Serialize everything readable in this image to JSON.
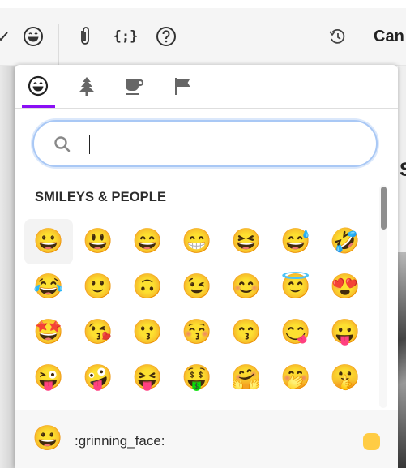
{
  "toolbar": {
    "icons": [
      {
        "name": "checkmark-icon",
        "glyph": "✓"
      },
      {
        "name": "emoji-icon",
        "glyph": "😄"
      },
      {
        "name": "paperclip-icon",
        "glyph": ""
      },
      {
        "name": "code-snippet-icon",
        "glyph": "{;}"
      },
      {
        "name": "help-icon",
        "glyph": "?"
      },
      {
        "name": "history-icon",
        "glyph": ""
      }
    ],
    "cancel_label": "Can"
  },
  "background": {
    "partial_heading": "S"
  },
  "picker": {
    "tabs": [
      {
        "name": "smileys",
        "icon": "smiley-icon",
        "active": true
      },
      {
        "name": "nature",
        "icon": "tree-icon",
        "active": false
      },
      {
        "name": "food",
        "icon": "cup-icon",
        "active": false
      },
      {
        "name": "flags",
        "icon": "flag-icon",
        "active": false
      }
    ],
    "accent_color": "#8a0ff5",
    "search": {
      "value": "",
      "placeholder": ""
    },
    "section_title": "SMILEYS & PEOPLE",
    "emojis": [
      {
        "char": "😀",
        "name": "grinning_face"
      },
      {
        "char": "😃",
        "name": "grinning_face_with_big_eyes"
      },
      {
        "char": "😄",
        "name": "grinning_face_with_smiling_eyes"
      },
      {
        "char": "😁",
        "name": "beaming_face_with_smiling_eyes"
      },
      {
        "char": "😆",
        "name": "grinning_squinting_face"
      },
      {
        "char": "😅",
        "name": "grinning_face_with_sweat"
      },
      {
        "char": "🤣",
        "name": "rolling_on_the_floor_laughing"
      },
      {
        "char": "😂",
        "name": "face_with_tears_of_joy"
      },
      {
        "char": "🙂",
        "name": "slightly_smiling_face"
      },
      {
        "char": "🙃",
        "name": "upside_down_face"
      },
      {
        "char": "😉",
        "name": "winking_face"
      },
      {
        "char": "😊",
        "name": "smiling_face_with_smiling_eyes"
      },
      {
        "char": "😇",
        "name": "smiling_face_with_halo"
      },
      {
        "char": "😍",
        "name": "smiling_face_with_heart_eyes"
      },
      {
        "char": "🤩",
        "name": "star_struck"
      },
      {
        "char": "😘",
        "name": "face_blowing_a_kiss"
      },
      {
        "char": "😗",
        "name": "kissing_face"
      },
      {
        "char": "😚",
        "name": "kissing_face_with_closed_eyes"
      },
      {
        "char": "😙",
        "name": "kissing_face_with_smiling_eyes"
      },
      {
        "char": "😋",
        "name": "face_savoring_food"
      },
      {
        "char": "😛",
        "name": "face_with_tongue"
      },
      {
        "char": "😜",
        "name": "winking_face_with_tongue"
      },
      {
        "char": "🤪",
        "name": "zany_face"
      },
      {
        "char": "😝",
        "name": "squinting_face_with_tongue"
      },
      {
        "char": "🤑",
        "name": "money_mouth_face"
      },
      {
        "char": "🤗",
        "name": "hugging_face"
      },
      {
        "char": "🤭",
        "name": "face_with_hand_over_mouth"
      },
      {
        "char": "🤫",
        "name": "shushing_face"
      }
    ],
    "selected_index": 0,
    "footer": {
      "preview_emoji": "😀",
      "preview_name": ":grinning_face:",
      "skin_tone_color": "#ffcc44"
    }
  }
}
